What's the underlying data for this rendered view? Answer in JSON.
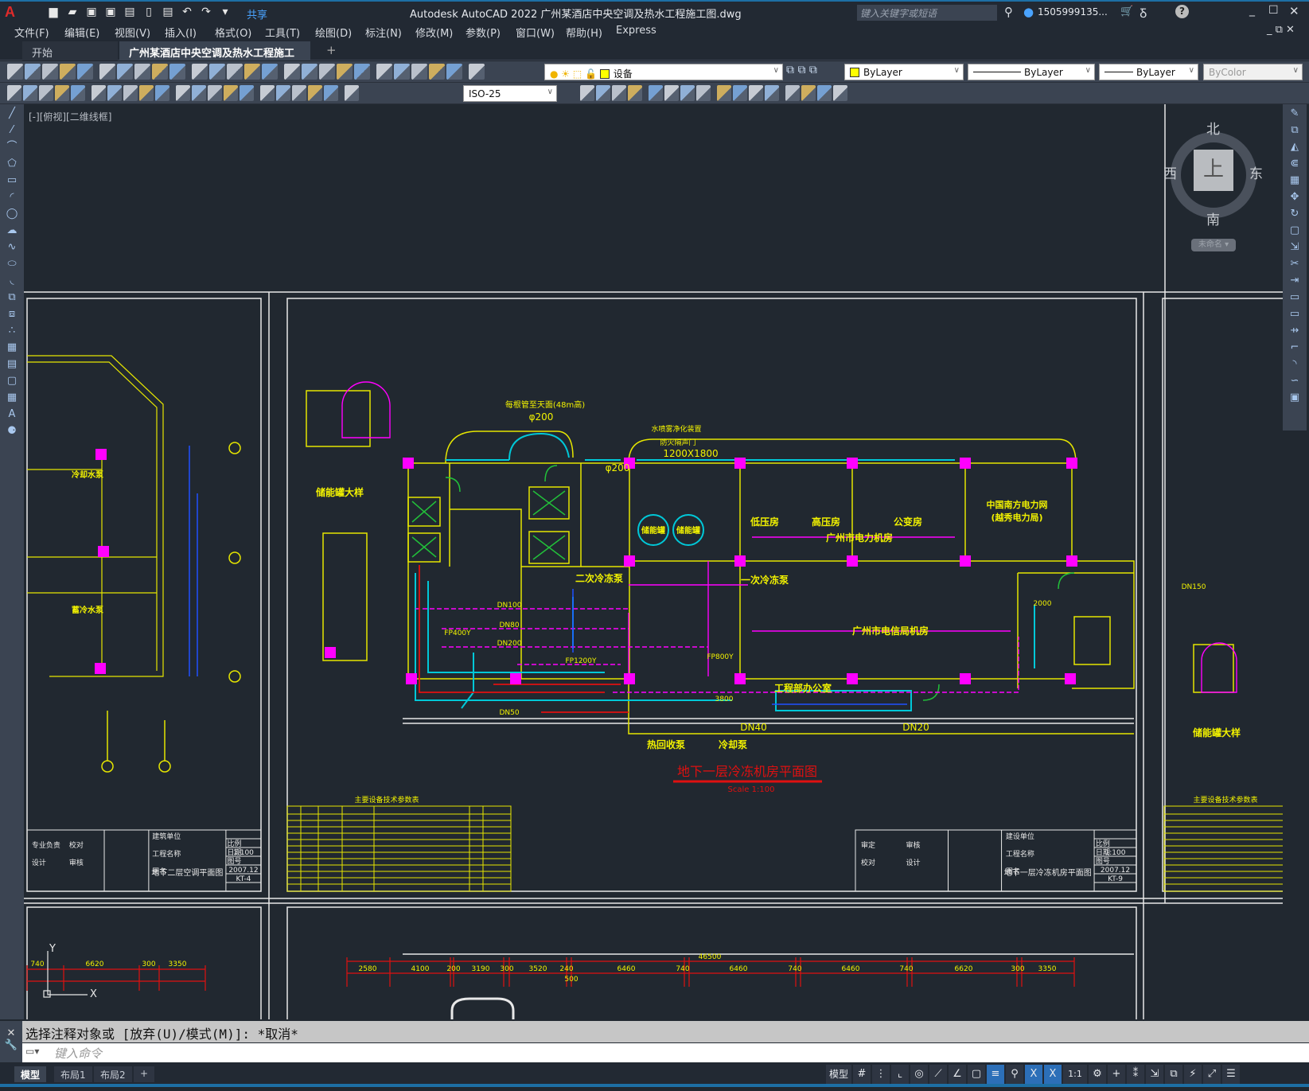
{
  "app": {
    "title": "Autodesk AutoCAD 2022    广州某酒店中央空调及热水工程施工图.dwg",
    "logo": "A",
    "share": "共享",
    "search_placeholder": "键入关键字或短语",
    "user": "1505999135...",
    "window_controls": [
      "minimize-icon",
      "maximize-icon",
      "close-icon"
    ]
  },
  "quick_access": [
    "new-icon",
    "open-icon",
    "save-icon",
    "save-as-icon",
    "publish-icon",
    "mobile-icon",
    "print-icon",
    "undo-icon",
    "redo-icon",
    "dropdown-icon"
  ],
  "menu": [
    "文件(F)",
    "编辑(E)",
    "视图(V)",
    "插入(I)",
    "格式(O)",
    "工具(T)",
    "绘图(D)",
    "标注(N)",
    "修改(M)",
    "参数(P)",
    "窗口(W)",
    "帮助(H)",
    "Express"
  ],
  "tabs": [
    {
      "label": "开始"
    },
    {
      "label": "广州某酒店中央空调及热水工程施工图*"
    }
  ],
  "toolbar": {
    "row1_icons": [
      "new",
      "open",
      "save",
      "plot",
      "plot-preview",
      "publish",
      "3d-dwf",
      "cut",
      "copy",
      "paste",
      "match-properties",
      "block-editor",
      "undo",
      "redo",
      "pan",
      "zoom-realtime",
      "zoom-window",
      "zoom-previous",
      "properties",
      "design-center",
      "tool-palettes",
      "sheet-set",
      "markup",
      "quick-calc",
      "help",
      "layer-properties"
    ],
    "layer": "设备",
    "color": "ByLayer",
    "linetype": "ByLayer",
    "lineweight": "ByLayer",
    "plotstyle": "ByColor",
    "row2_icons": [
      "edit-dim",
      "dim-linear",
      "dim-aligned",
      "dim-arc",
      "dim-ordinate",
      "dim-radius",
      "dim-jogged",
      "dim-diameter",
      "dim-angular",
      "quick-dim",
      "dim-baseline",
      "dim-continue",
      "dim-space",
      "dim-break",
      "tolerance",
      "center-mark",
      "inspect",
      "jogged-linear",
      "dim-edit",
      "dim-text-edit",
      "dim-update"
    ],
    "dimstyle": "ISO-25",
    "row3_icons": [
      "solid-union",
      "solid-subtract",
      "solid-intersect",
      "extrude-faces",
      "move-faces",
      "offset-faces",
      "delete-faces",
      "rotate-faces",
      "taper-faces",
      "copy-faces",
      "color-faces",
      "imprint",
      "clean",
      "separate",
      "shell",
      "check"
    ]
  },
  "left_palette": [
    "line",
    "construction-line",
    "polyline",
    "polygon",
    "rectangle",
    "arc",
    "circle",
    "revision-cloud",
    "spline",
    "ellipse",
    "ellipse-arc",
    "insert-block",
    "make-block",
    "point",
    "hatch",
    "gradient",
    "region",
    "table",
    "multiline-text",
    "add-selected"
  ],
  "right_palette": [
    "erase",
    "copy",
    "mirror",
    "offset",
    "array",
    "move",
    "rotate",
    "scale",
    "stretch",
    "trim",
    "extend",
    "break-at-point",
    "break",
    "join",
    "chamfer",
    "fillet",
    "blend-curves",
    "explode"
  ],
  "viewport_label": "[-][俯视][二维线框]",
  "viewcube": {
    "north": "北",
    "south": "南",
    "east": "东",
    "west": "西",
    "face": "上",
    "ucs": "未命名"
  },
  "drawing": {
    "title": "地下一层冷冻机房平面图",
    "scale": "Scale 1:100",
    "rooms": [
      "低压房",
      "高压房",
      "公变房",
      "广州市电力机房",
      "中国南方电力网",
      "(越秀电力局)",
      "二次冷冻泵",
      "一次冷冻泵",
      "广州市电信局机房",
      "工程部办公室",
      "热回收泵",
      "冷却泵",
      "储能罐",
      "储能罐",
      "储能罐大样",
      "储能罐大样",
      "冷却水泵",
      "蓄冷水泵"
    ],
    "notes": [
      "每根管至天面(48m高)",
      "φ200",
      "φ200",
      "水喷雾净化装置",
      "防火隔声门",
      "1200X1800",
      "DN40",
      "DN20",
      "DN100",
      "DN80",
      "DN200",
      "DN150",
      "DN50",
      "FP400Y",
      "FP800Y",
      "FP1200Y",
      "3800",
      "2000"
    ],
    "dims_main": {
      "total": "46500",
      "segments": [
        "2580",
        "4100",
        "200",
        "3190",
        "300",
        "3520",
        "240",
        "500",
        "6460",
        "740",
        "6460",
        "740",
        "6460",
        "740",
        "6620",
        "300",
        "3350"
      ]
    },
    "dims_left": [
      "740",
      "6620",
      "300",
      "3350"
    ],
    "table_title": "主要设备技术参数表",
    "title_blocks": [
      {
        "drawing": "地下二层空调平面图",
        "scale": "1:100",
        "date": "2007.12",
        "number": "KT-4",
        "fields": [
          "建筑单位",
          "工程名称",
          "图名",
          "比例",
          "日期",
          "图号",
          "专业负责",
          "校对",
          "设计",
          "审核"
        ]
      },
      {
        "drawing": "地下一层冷冻机房平面图",
        "scale": "1:100",
        "date": "2007.12",
        "number": "KT-9",
        "fields": [
          "建设单位",
          "工程名称",
          "图名",
          "比例",
          "日期",
          "图号",
          "审定",
          "审核",
          "校对",
          "设计"
        ]
      }
    ]
  },
  "command": {
    "history": "选择注释对象或 [放弃(U)/模式(M)]: *取消*",
    "placeholder": "键入命令"
  },
  "layouts": [
    "模型",
    "布局1",
    "布局2",
    "+"
  ],
  "status": {
    "model": "模型",
    "scale": "1:1",
    "items": [
      "grid",
      "snap",
      "ortho",
      "polar",
      "isodraft",
      "object-snap-tracking",
      "object-snap",
      "lineweight",
      "transparency",
      "annotation-visibility",
      "auto-scale",
      "annotation-scale",
      "workspace",
      "annotation-monitor",
      "units",
      "quick-properties",
      "isolate",
      "graphics-performance",
      "fullscreen",
      "customize"
    ]
  },
  "colors": {
    "accent": "#1d6fa5",
    "wall": "#e6e600",
    "column": "#ff00ff",
    "pipe_cyan": "#00c8d8",
    "title_red": "#e01010",
    "dim_red": "#e01010"
  }
}
